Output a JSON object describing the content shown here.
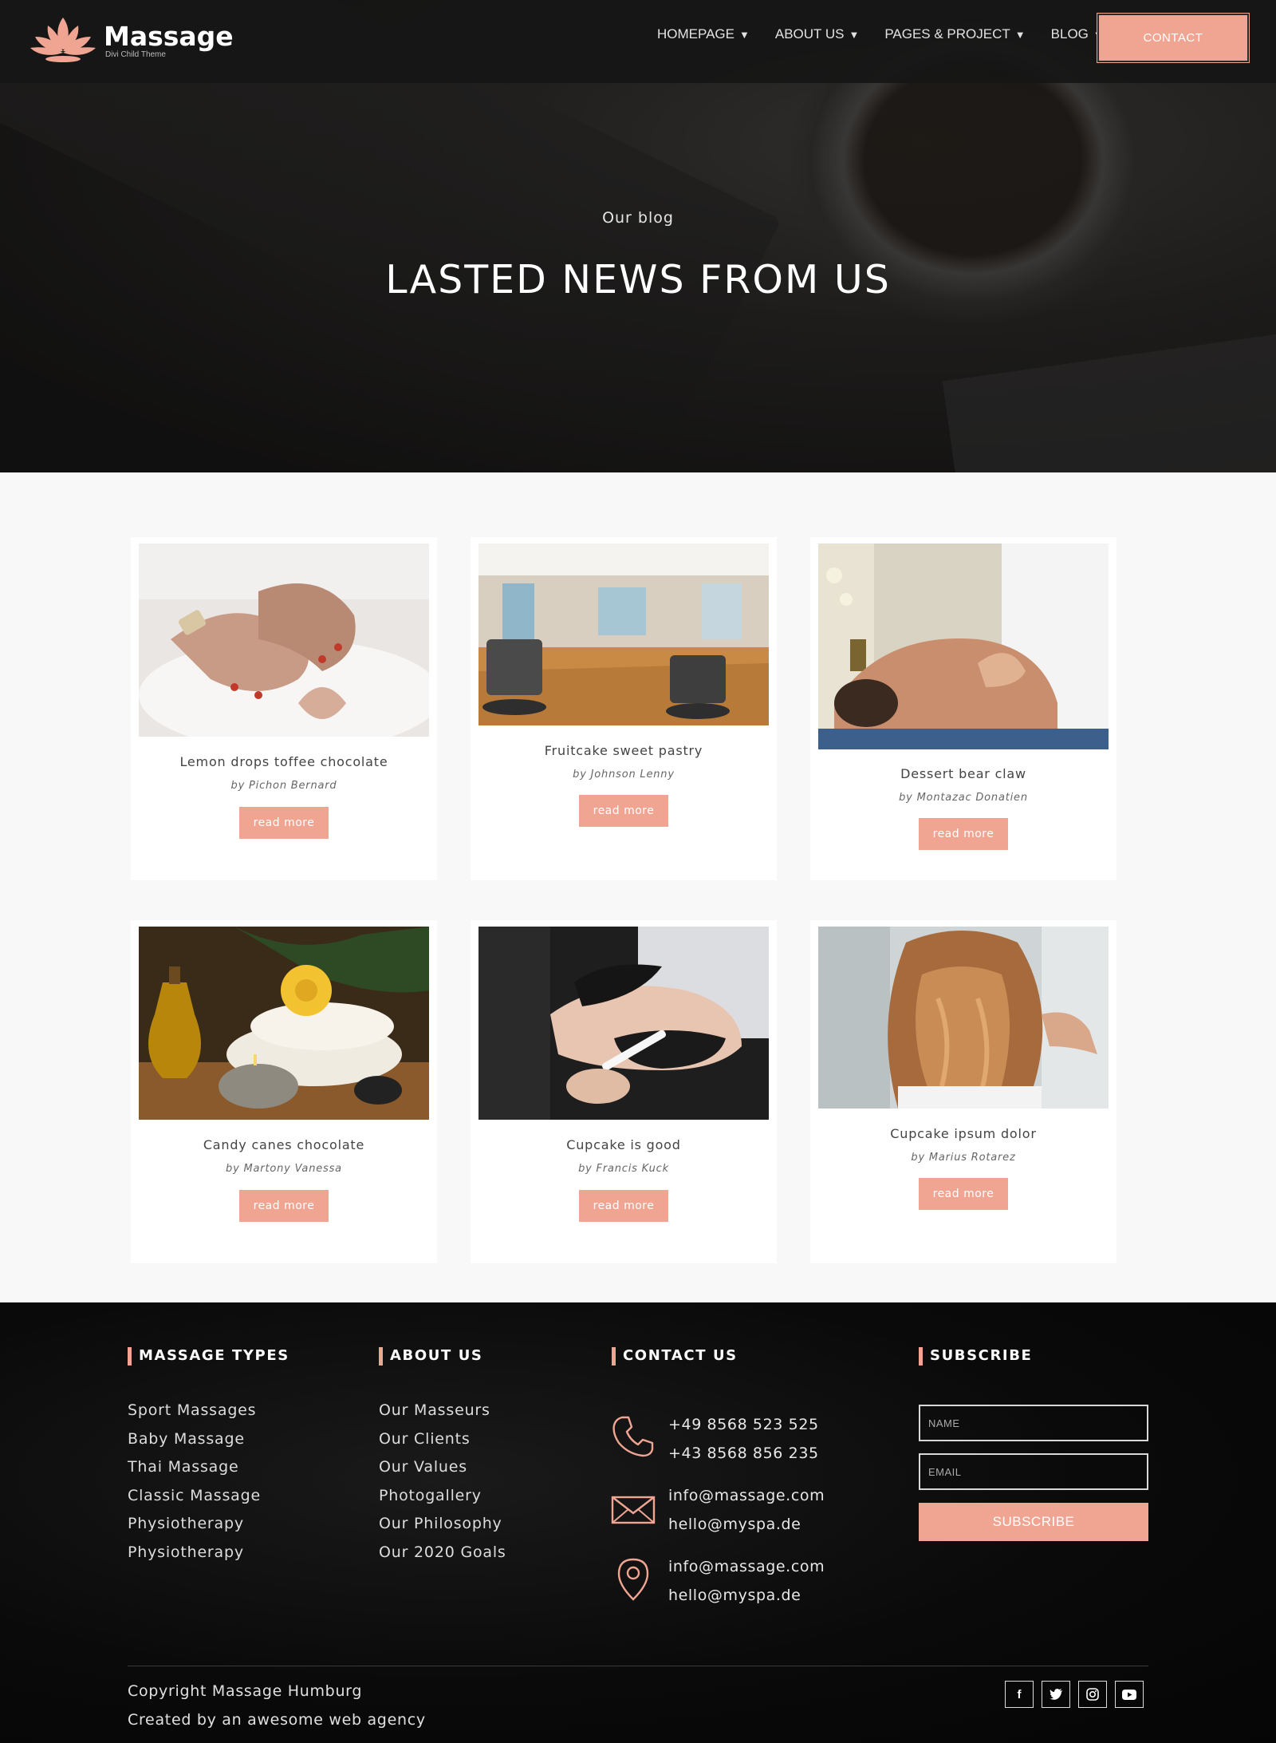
{
  "brand": {
    "name": "Massage",
    "tagline": "Divi Child Theme",
    "accent": "#f0a593"
  },
  "nav": {
    "items": [
      {
        "label": "HOMEPAGE"
      },
      {
        "label": "ABOUT US"
      },
      {
        "label": "PAGES & PROJECT"
      },
      {
        "label": "BLOG"
      }
    ],
    "contact_label": "CONTACT"
  },
  "hero": {
    "kicker": "Our blog",
    "title": "LASTED NEWS FROM US"
  },
  "posts": [
    {
      "title": "Lemon drops toffee chocolate",
      "author": "by Pichon Bernard",
      "cta": "read more",
      "image": "manicure-hands-photo"
    },
    {
      "title": "Fruitcake sweet pastry",
      "author": "by Johnson Lenny",
      "cta": "read more",
      "image": "salon-interior-photo"
    },
    {
      "title": "Dessert bear claw",
      "author": "by Montazac Donatien",
      "cta": "read more",
      "image": "back-massage-photo"
    },
    {
      "title": "Candy canes chocolate",
      "author": "by Martony Vanessa",
      "cta": "read more",
      "image": "spa-candle-towels-photo"
    },
    {
      "title": "Cupcake is good",
      "author": "by Francis Kuck",
      "cta": "read more",
      "image": "face-mask-treatment-photo"
    },
    {
      "title": "Cupcake ipsum dolor",
      "author": "by Marius Rotarez",
      "cta": "read more",
      "image": "hair-styling-photo"
    }
  ],
  "footer": {
    "massage_types": {
      "title": "MASSAGE TYPES",
      "items": [
        "Sport Massages",
        "Baby Massage",
        "Thai Massage",
        "Classic Massage",
        "Physiotherapy",
        "Physiotherapy"
      ]
    },
    "about": {
      "title": "ABOUT US",
      "items": [
        "Our Masseurs",
        "Our Clients",
        "Our Values",
        "Photogallery",
        "Our Philosophy",
        "Our 2020 Goals"
      ]
    },
    "contact": {
      "title": "CONTACT US",
      "phones": [
        "+49 8568 523 525",
        "+43 8568 856 235"
      ],
      "emails": [
        "info@massage.com",
        "hello@myspa.de"
      ],
      "address": [
        "info@massage.com",
        "hello@myspa.de"
      ]
    },
    "subscribe": {
      "title": "SUBSCRIBE",
      "name_placeholder": "NAME",
      "email_placeholder": "EMAIL",
      "button": "SUBSCRIBE"
    },
    "copyright": [
      "Copyright Massage Humburg",
      "Created by an awesome web agency"
    ],
    "social": [
      "facebook-icon",
      "twitter-icon",
      "instagram-icon",
      "youtube-icon"
    ]
  }
}
